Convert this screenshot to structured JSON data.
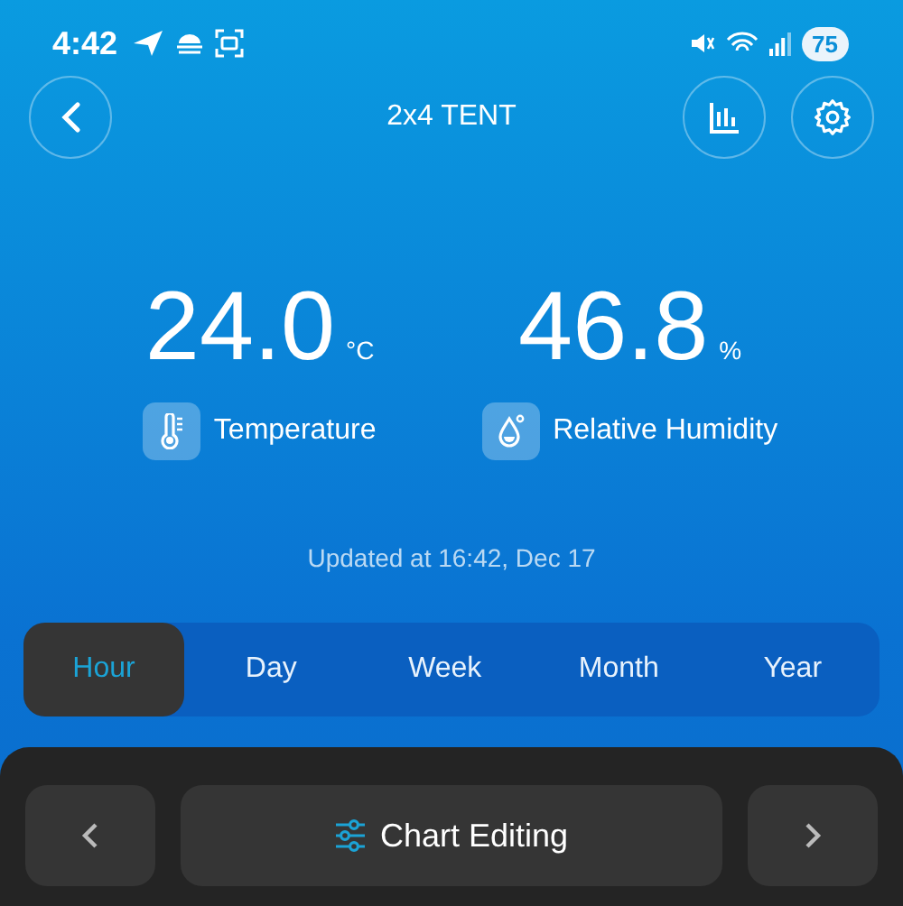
{
  "status_bar": {
    "time": "4:42",
    "battery": "75"
  },
  "header": {
    "title": "2x4 TENT"
  },
  "readings": [
    {
      "kind": "temperature",
      "value": "24.0",
      "unit": "°C",
      "label": "Temperature"
    },
    {
      "kind": "humidity",
      "value": "46.8",
      "unit": "%",
      "label": "Relative Humidity"
    }
  ],
  "updated": "Updated at 16:42, Dec 17",
  "tabs": [
    {
      "label": "Hour",
      "selected": true
    },
    {
      "label": "Day",
      "selected": false
    },
    {
      "label": "Week",
      "selected": false
    },
    {
      "label": "Month",
      "selected": false
    },
    {
      "label": "Year",
      "selected": false
    }
  ],
  "bottom_bar": {
    "center_button": "Chart Editing"
  }
}
